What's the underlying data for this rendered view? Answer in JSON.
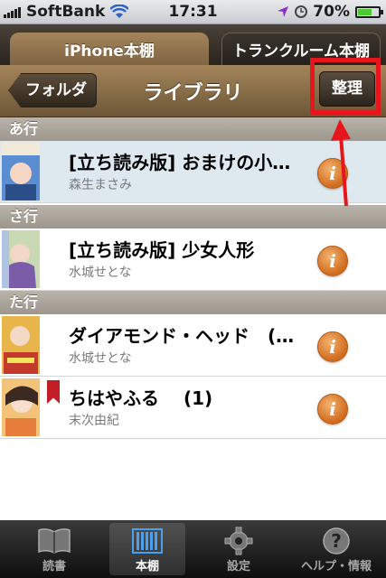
{
  "status": {
    "carrier": "SoftBank",
    "time": "17:31",
    "battery": "70%",
    "battery_level": 0.7
  },
  "shelf_tabs": [
    {
      "label": "iPhone本棚",
      "active": true
    },
    {
      "label": "トランクルーム本棚",
      "active": false
    }
  ],
  "nav": {
    "back_label": "フォルダ",
    "title": "ライブラリ",
    "organize_label": "整理"
  },
  "sections": [
    "あ行",
    "さ行",
    "た行"
  ],
  "books": [
    {
      "title": "[立ち読み版] おまけの小…",
      "author": "森生まさみ"
    },
    {
      "title": "[立ち読み版] 少女人形",
      "author": "水城せとな"
    },
    {
      "title": "ダイアモンド・ヘッド　(…",
      "author": "水城せとな"
    },
    {
      "title": "ちはやふる　 (1)",
      "author": "末次由紀"
    }
  ],
  "tabbar": [
    {
      "label": "読書"
    },
    {
      "label": "本棚"
    },
    {
      "label": "設定"
    },
    {
      "label": "ヘルプ・情報"
    }
  ],
  "colors": {
    "highlight": "#e6161c",
    "info": "#d06b1c",
    "nav": "#8c6f48"
  }
}
